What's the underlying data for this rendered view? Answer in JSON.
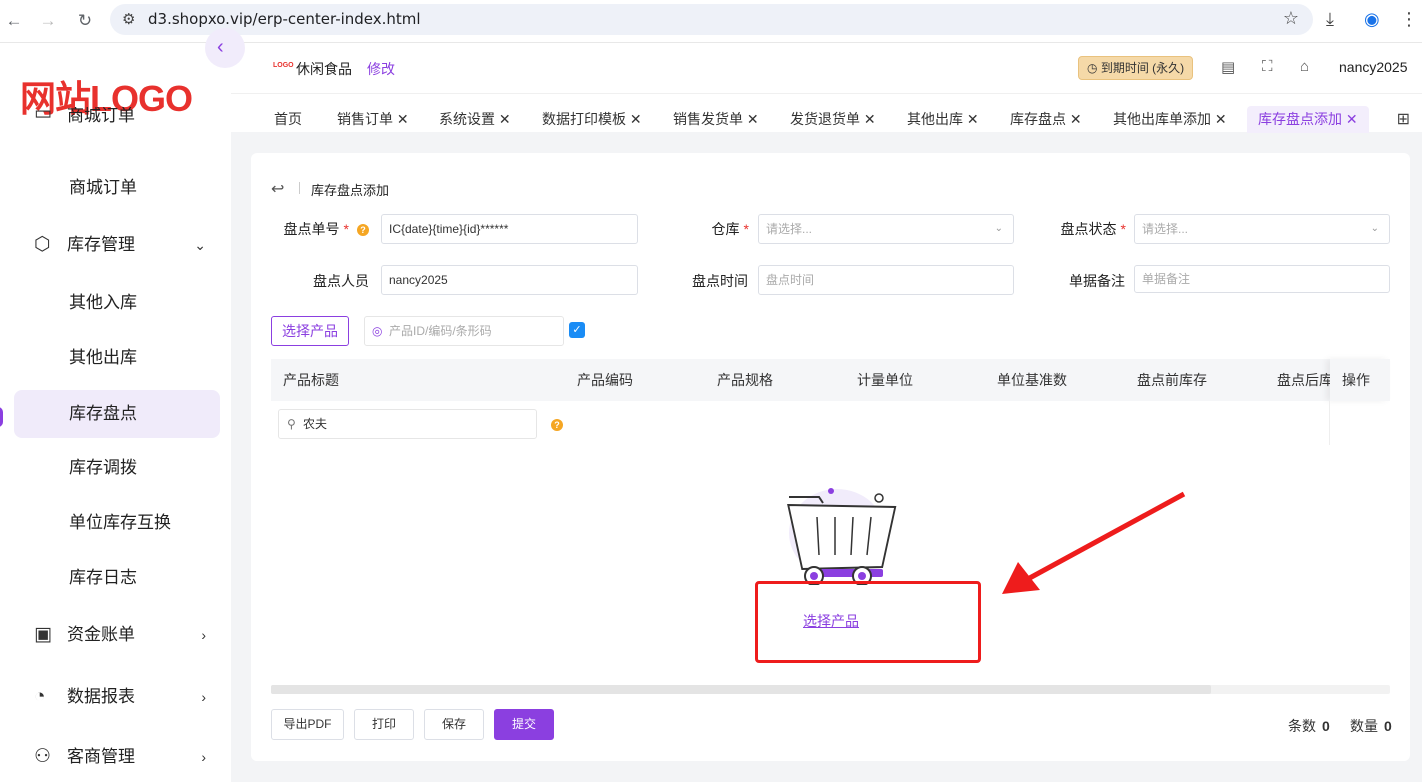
{
  "browser": {
    "url": "d3.shopxo.vip/erp-center-index.html"
  },
  "sidebar": {
    "logo": "网站LOGO",
    "items": [
      {
        "label": "商城订单",
        "icon": "order-icon",
        "kind": "top"
      },
      {
        "label": "商城订单",
        "kind": "sub"
      },
      {
        "label": "库存管理",
        "icon": "cube-icon",
        "kind": "top",
        "expanded": true
      },
      {
        "label": "其他入库",
        "kind": "sub"
      },
      {
        "label": "其他出库",
        "kind": "sub"
      },
      {
        "label": "库存盘点",
        "kind": "sub",
        "active": true
      },
      {
        "label": "库存调拨",
        "kind": "sub"
      },
      {
        "label": "单位库存互换",
        "kind": "sub"
      },
      {
        "label": "库存日志",
        "kind": "sub"
      },
      {
        "label": "资金账单",
        "icon": "wallet-icon",
        "kind": "top"
      },
      {
        "label": "数据报表",
        "icon": "pie-chart-icon",
        "kind": "top"
      },
      {
        "label": "客商管理",
        "icon": "users-icon",
        "kind": "top"
      }
    ]
  },
  "header": {
    "shop_logo": "LOGO",
    "shop_name": "休闲食品",
    "edit_label": "修改",
    "expire_label": "到期时间 (永久)",
    "username": "nancy2025"
  },
  "tabs": [
    {
      "label": "首页",
      "closable": false
    },
    {
      "label": "销售订单",
      "closable": true
    },
    {
      "label": "系统设置",
      "closable": true
    },
    {
      "label": "数据打印模板",
      "closable": true
    },
    {
      "label": "销售发货单",
      "closable": true
    },
    {
      "label": "发货退货单",
      "closable": true
    },
    {
      "label": "其他出库",
      "closable": true
    },
    {
      "label": "库存盘点",
      "closable": true
    },
    {
      "label": "其他出库单添加",
      "closable": true
    },
    {
      "label": "库存盘点添加",
      "closable": true,
      "active": true
    }
  ],
  "page": {
    "title": "库存盘点添加"
  },
  "form": {
    "order_no": {
      "label": "盘点单号",
      "value": "IC{date}{time}{id}******"
    },
    "warehouse": {
      "label": "仓库",
      "placeholder": "请选择..."
    },
    "status": {
      "label": "盘点状态",
      "placeholder": "请选择..."
    },
    "person": {
      "label": "盘点人员",
      "value": "nancy2025"
    },
    "time": {
      "label": "盘点时间",
      "placeholder": "盘点时间"
    },
    "remark": {
      "label": "单据备注",
      "placeholder": "单据备注"
    }
  },
  "product_bar": {
    "select_button": "选择产品",
    "search_placeholder": "产品ID/编码/条形码",
    "checked": true
  },
  "table": {
    "columns": [
      "产品标题",
      "产品编码",
      "产品规格",
      "计量单位",
      "单位基准数",
      "盘点前库存",
      "盘点后库"
    ],
    "op_column": "操作",
    "filter_value": "农夫",
    "empty_link": "选择产品"
  },
  "footer": {
    "buttons": [
      "导出PDF",
      "打印",
      "保存",
      "提交"
    ],
    "count_label": "条数",
    "count_value": "0",
    "qty_label": "数量",
    "qty_value": "0"
  },
  "colors": {
    "accent": "#8b3fe0",
    "logo_red": "#e8312d",
    "annotation_red": "#ee1c1c"
  }
}
